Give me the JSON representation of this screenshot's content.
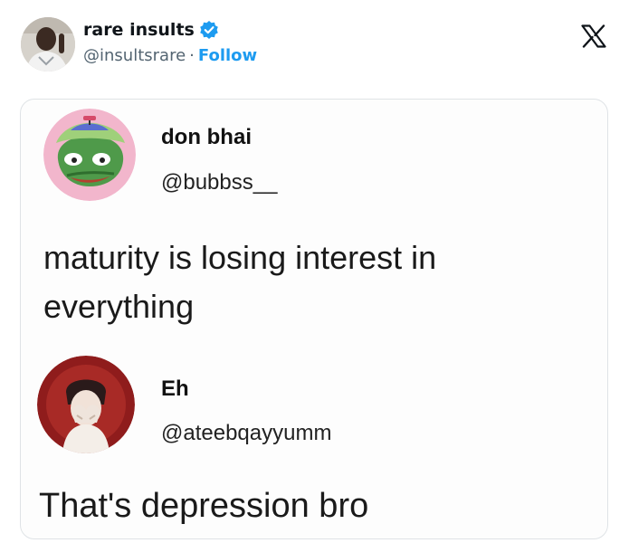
{
  "author": {
    "name": "rare insults",
    "handle": "@insultsrare",
    "separator": "·",
    "follow_label": "Follow",
    "verified": true
  },
  "platform_icon": "x-logo-icon",
  "colors": {
    "accent": "#1d9bf0",
    "text_primary": "#0f1419",
    "text_secondary": "#536471",
    "card_border": "#dfe3e6"
  },
  "embedded_image": {
    "original_post": {
      "name": "don bhai",
      "handle": "@bubbss__",
      "text": "maturity is losing interest in everything"
    },
    "reply_post": {
      "name": "Eh",
      "handle": "@ateebqayyumm",
      "text": "That's depression bro"
    }
  }
}
